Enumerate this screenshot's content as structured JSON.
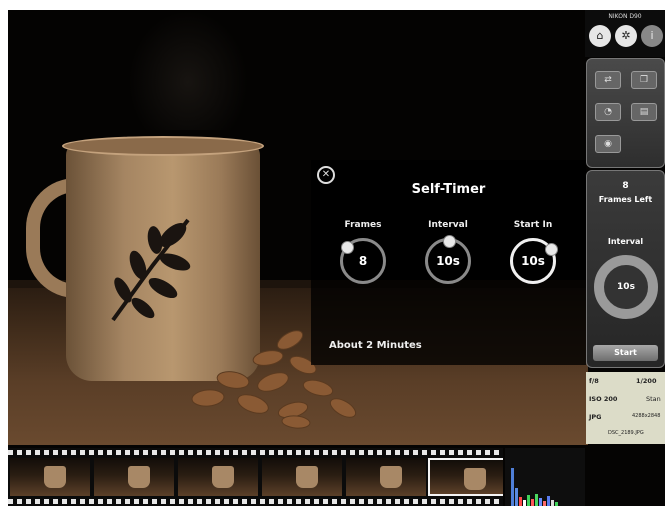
{
  "camera": {
    "model": "NIKON D90"
  },
  "top_buttons": [
    {
      "icon": "home-icon",
      "glyph": "⌂"
    },
    {
      "icon": "settings-icon",
      "glyph": "✲"
    },
    {
      "icon": "info-icon",
      "glyph": "i"
    }
  ],
  "self_timer": {
    "title": "Self-Timer",
    "close_glyph": "✕",
    "dials": [
      {
        "label": "Frames",
        "value": "8"
      },
      {
        "label": "Interval",
        "value": "10s"
      },
      {
        "label": "Start In",
        "value": "10s"
      }
    ],
    "footer": "About 2 Minutes"
  },
  "interval_panel": {
    "frames_count": "8",
    "frames_left_label": "Frames Left",
    "interval_label": "Interval",
    "interval_value": "10s",
    "start_label": "Start"
  },
  "shot_info": {
    "aperture": "f/8",
    "shutter": "1/200",
    "iso": "ISO 200",
    "metering": "Stan",
    "format": "JPG",
    "size": "4288x2848",
    "filename": "DSC_2189.JPG"
  },
  "filmstrip": {
    "selected_index": 5,
    "count": 6
  },
  "colors": {
    "accent": "#e8e8e8",
    "panel": "#2e2e2e",
    "info_bg": "#dcdcc8"
  }
}
